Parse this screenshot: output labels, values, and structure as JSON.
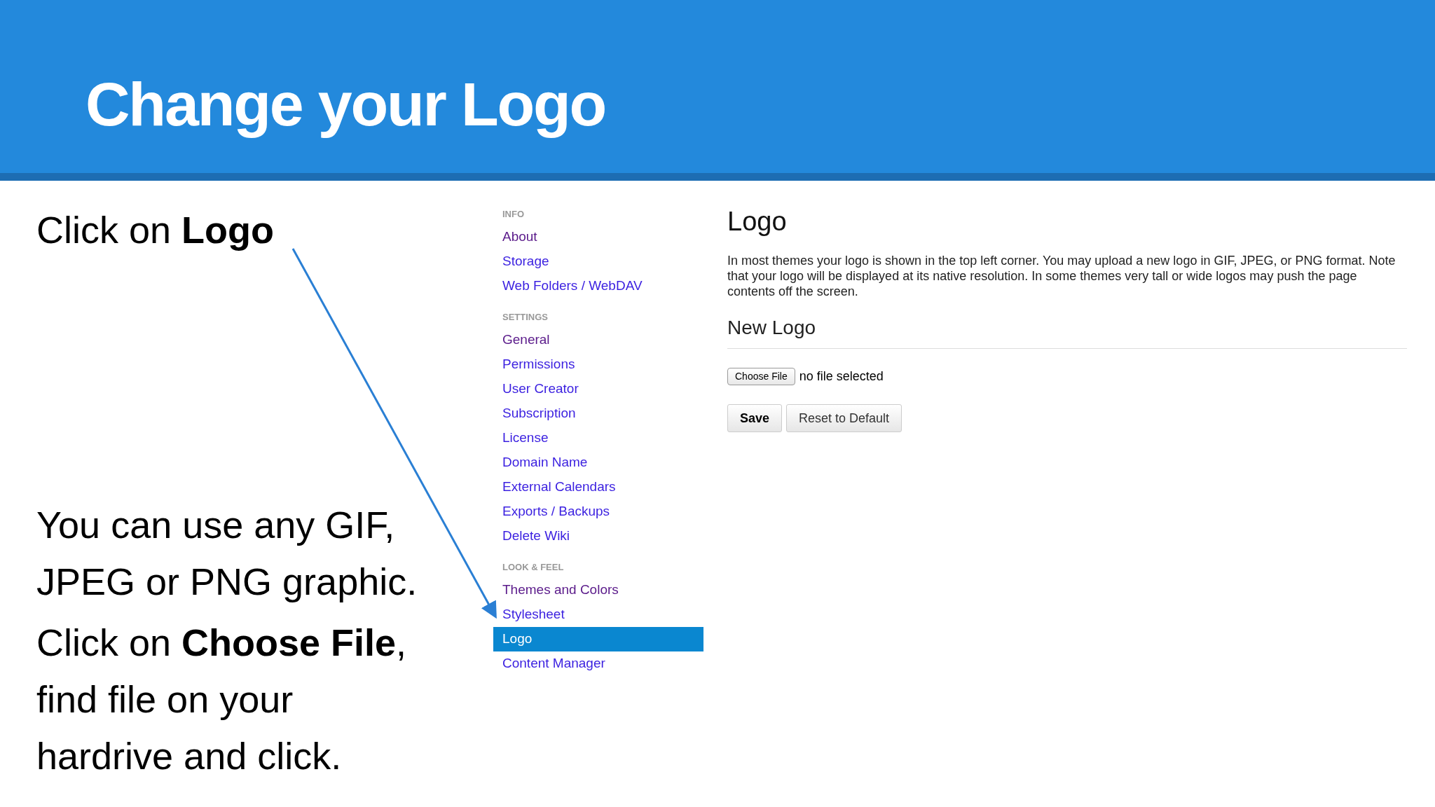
{
  "slide": {
    "title": "Change your Logo",
    "notes": [
      {
        "lines": [
          "Click on **Logo**"
        ]
      },
      {
        "lines": [
          "You can use any GIF,",
          "JPEG or PNG graphic."
        ]
      },
      {
        "lines": [
          "Click on **Choose File**,",
          "find file on your",
          "hardrive and click."
        ]
      }
    ]
  },
  "sidebar": {
    "sections": [
      {
        "heading": "INFO",
        "items": [
          {
            "label": "About",
            "visited": true,
            "selected": false
          },
          {
            "label": "Storage",
            "visited": false,
            "selected": false
          },
          {
            "label": "Web Folders / WebDAV",
            "visited": false,
            "selected": false
          }
        ]
      },
      {
        "heading": "SETTINGS",
        "items": [
          {
            "label": "General",
            "visited": true,
            "selected": false
          },
          {
            "label": "Permissions",
            "visited": false,
            "selected": false
          },
          {
            "label": "User Creator",
            "visited": false,
            "selected": false
          },
          {
            "label": "Subscription",
            "visited": false,
            "selected": false
          },
          {
            "label": "License",
            "visited": false,
            "selected": false
          },
          {
            "label": "Domain Name",
            "visited": false,
            "selected": false
          },
          {
            "label": "External Calendars",
            "visited": false,
            "selected": false
          },
          {
            "label": "Exports / Backups",
            "visited": false,
            "selected": false
          },
          {
            "label": "Delete Wiki",
            "visited": false,
            "selected": false
          }
        ]
      },
      {
        "heading": "LOOK & FEEL",
        "items": [
          {
            "label": "Themes and Colors",
            "visited": true,
            "selected": false
          },
          {
            "label": "Stylesheet",
            "visited": false,
            "selected": false
          },
          {
            "label": "Logo",
            "visited": false,
            "selected": true
          },
          {
            "label": "Content Manager",
            "visited": false,
            "selected": false
          }
        ]
      }
    ]
  },
  "main": {
    "title": "Logo",
    "description": "In most themes your logo is shown in the top left corner. You may upload a new logo in GIF, JPEG, or PNG format. Note that your logo will be displayed at its native resolution. In some themes very tall or wide logos may push the page contents off the screen.",
    "section_title": "New Logo",
    "file_button": "Choose File",
    "file_status": "no file selected",
    "buttons": [
      {
        "label": "Save",
        "primary": true
      },
      {
        "label": "Reset to Default",
        "primary": false
      }
    ]
  }
}
